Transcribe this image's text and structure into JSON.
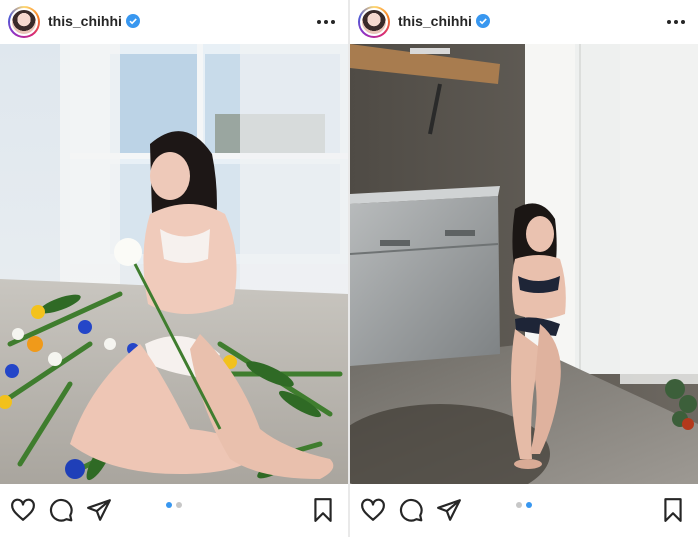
{
  "posts": [
    {
      "username": "this_chihhi",
      "more_icon": "more-horizontal-icon",
      "carousel": {
        "count": 2,
        "active": 1
      },
      "actions": [
        "heart-icon",
        "comment-icon",
        "share-icon",
        "bookmark-icon"
      ]
    },
    {
      "username": "this_chihhi",
      "more_icon": "more-horizontal-icon",
      "carousel": {
        "count": 2,
        "active": 2
      },
      "actions": [
        "heart-icon",
        "comment-icon",
        "share-icon",
        "bookmark-icon"
      ]
    }
  ],
  "colors": {
    "verified": "#3897f0",
    "active_dot": "#3897f0",
    "inactive_dot": "#c7c7c7",
    "icon": "#262626"
  }
}
